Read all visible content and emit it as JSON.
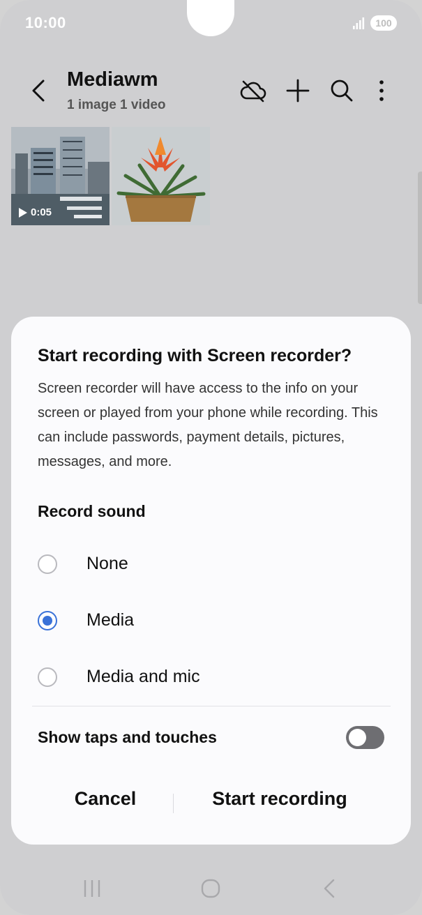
{
  "status_bar": {
    "time": "10:00",
    "battery": "100"
  },
  "header": {
    "title": "Mediawm",
    "subtitle": "1 image 1 video",
    "icons": [
      "back-icon",
      "cloud-off-icon",
      "add-icon",
      "search-icon",
      "more-icon"
    ]
  },
  "gallery": {
    "items": [
      {
        "type": "video",
        "duration": "0:05"
      },
      {
        "type": "image"
      }
    ]
  },
  "dialog": {
    "title": "Start recording with Screen recorder?",
    "body": "Screen recorder will have access to the info on your screen or played from your phone while recording. This can include passwords, payment details, pictures, messages, and more.",
    "section_label": "Record sound",
    "options": [
      {
        "label": "None",
        "selected": false
      },
      {
        "label": "Media",
        "selected": true
      },
      {
        "label": "Media and mic",
        "selected": false
      }
    ],
    "toggle_label": "Show taps and touches",
    "toggle_on": false,
    "cancel_label": "Cancel",
    "confirm_label": "Start recording"
  },
  "colors": {
    "accent": "#3a72d8",
    "scrim": "#cfcfd1",
    "dialog": "#fbfbfd"
  }
}
